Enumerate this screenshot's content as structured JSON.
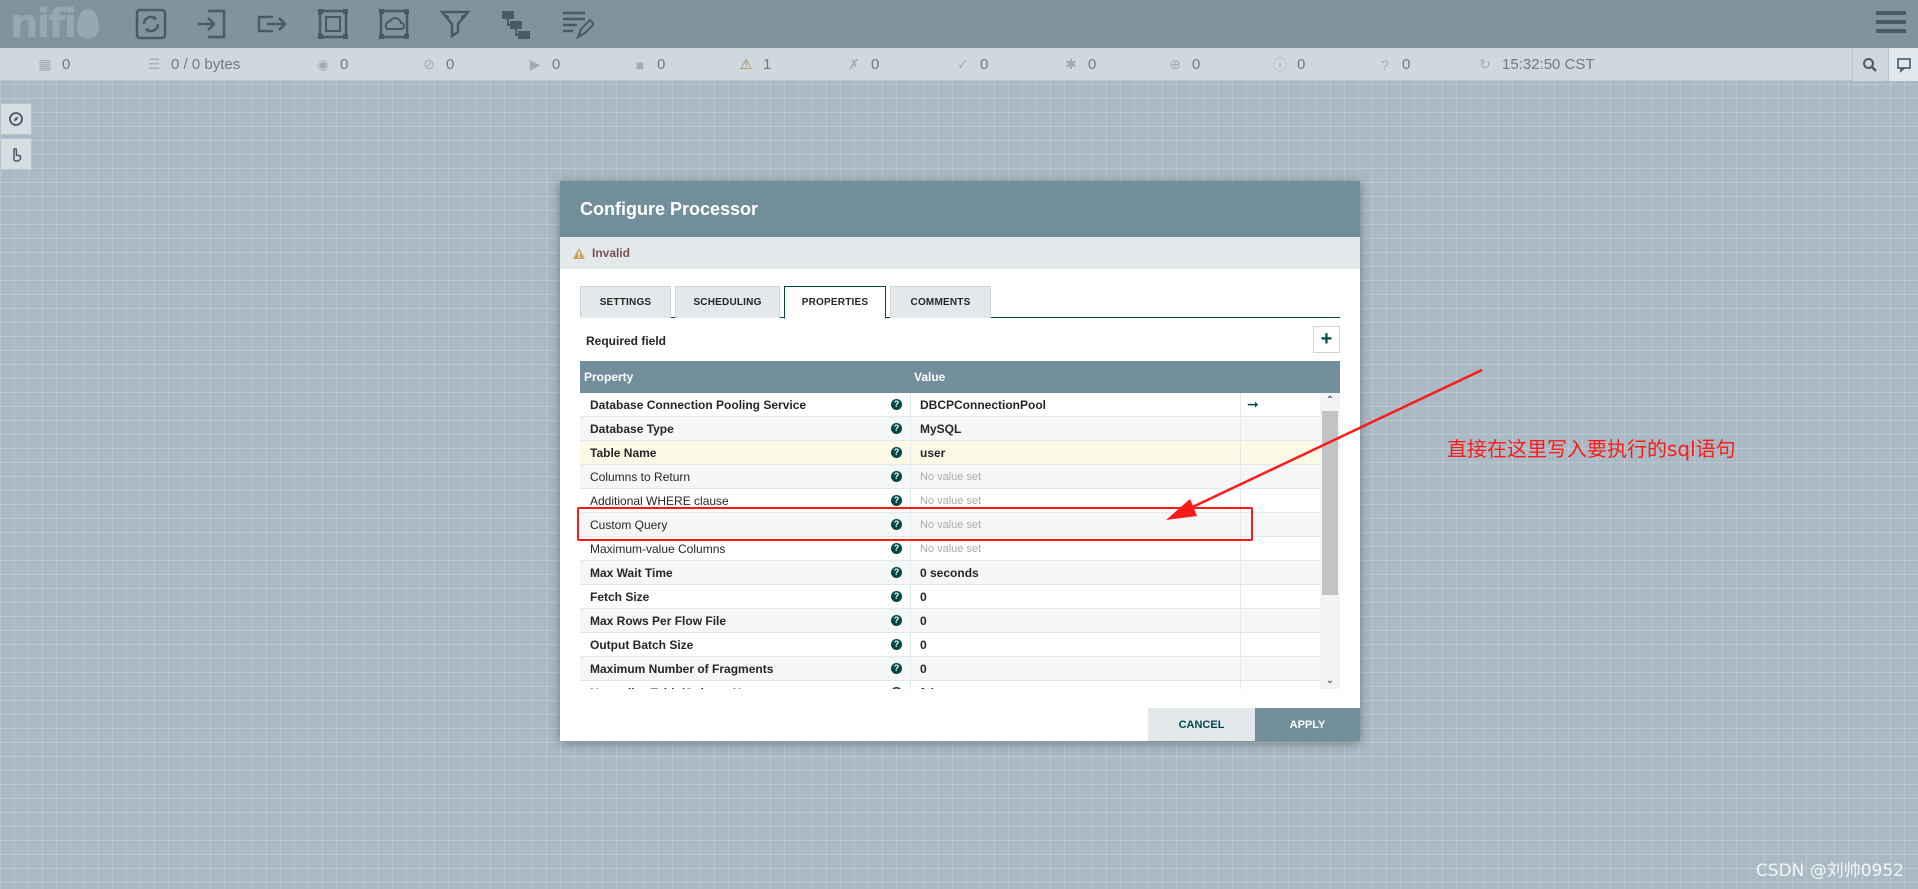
{
  "toolbar": {
    "logo": "nifi",
    "buttons": [
      "processor-icon",
      "input-port-icon",
      "output-port-icon",
      "process-group-icon",
      "remote-process-group-icon",
      "funnel-icon",
      "template-icon",
      "label-icon"
    ]
  },
  "status": {
    "threads": "0",
    "queued": "0 / 0 bytes",
    "transmitting": "0",
    "not_transmitting": "0",
    "running": "0",
    "stopped": "0",
    "invalid": "1",
    "disabled": "0",
    "up_to_date": "0",
    "locally_modified": "0",
    "stale": "0",
    "locally_modified_stale": "0",
    "sync_failure": "0",
    "last_refresh": "15:32:50 CST"
  },
  "dialog": {
    "title": "Configure Processor",
    "status_text": "Invalid",
    "tabs": [
      {
        "label": "SETTINGS"
      },
      {
        "label": "SCHEDULING"
      },
      {
        "label": "PROPERTIES"
      },
      {
        "label": "COMMENTS"
      }
    ],
    "required_label": "Required field",
    "add_symbol": "+",
    "columns": {
      "property": "Property",
      "value": "Value"
    },
    "rows": [
      {
        "name": "Database Connection Pooling Service",
        "value": "DBCPConnectionPool"
      },
      {
        "name": "Database Type",
        "value": "MySQL"
      },
      {
        "name": "Table Name",
        "value": "user"
      },
      {
        "name": "Columns to Return",
        "value": "No value set"
      },
      {
        "name": "Additional WHERE clause",
        "value": "No value set"
      },
      {
        "name": "Custom Query",
        "value": "No value set"
      },
      {
        "name": "Maximum-value Columns",
        "value": "No value set"
      },
      {
        "name": "Max Wait Time",
        "value": "0 seconds"
      },
      {
        "name": "Fetch Size",
        "value": "0"
      },
      {
        "name": "Max Rows Per Flow File",
        "value": "0"
      },
      {
        "name": "Output Batch Size",
        "value": "0"
      },
      {
        "name": "Maximum Number of Fragments",
        "value": "0"
      },
      {
        "name": "Normalize Table/Column Names",
        "value": "false"
      }
    ],
    "cancel_label": "CANCEL",
    "apply_label": "APPLY"
  },
  "annotation": {
    "note": "直接在这里写入要执行的sql语句",
    "color": "#ff1a1a"
  },
  "watermark": "CSDN @刘帅0952"
}
